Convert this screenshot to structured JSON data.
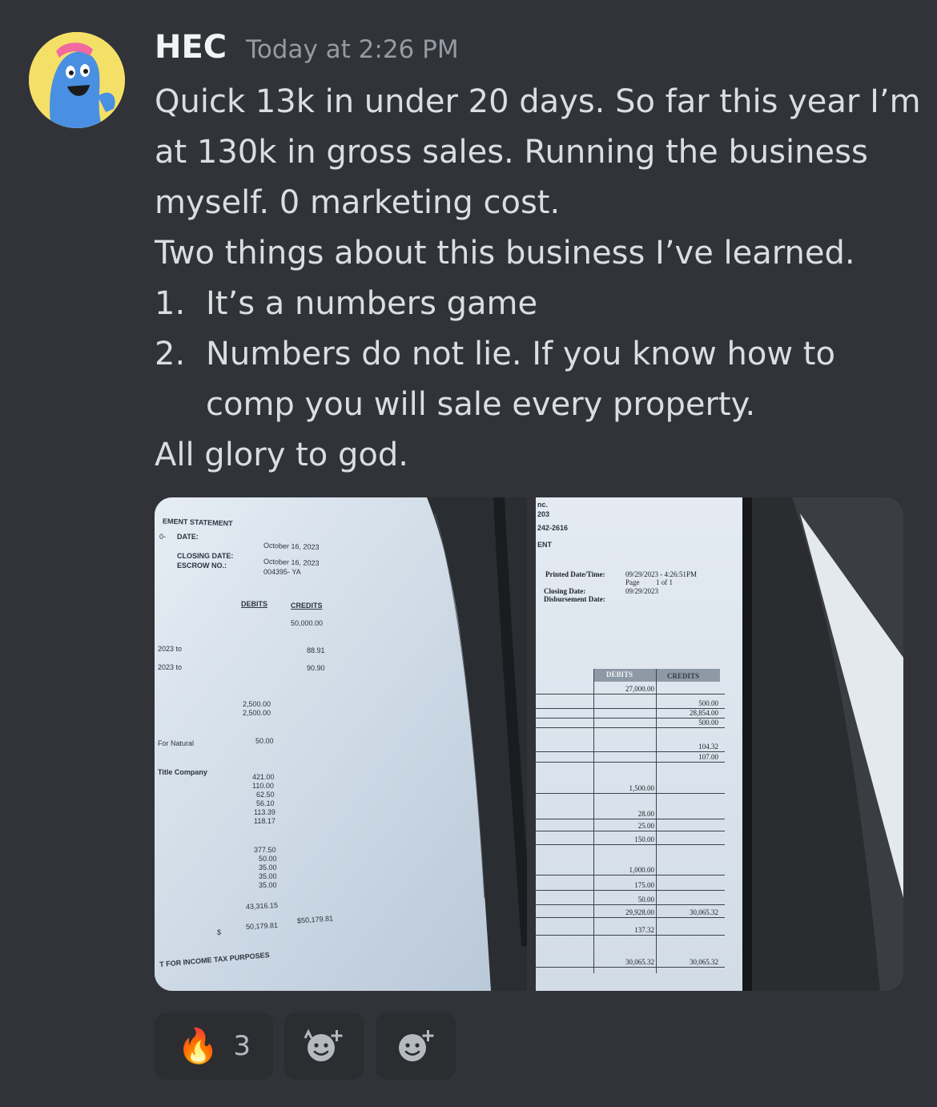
{
  "message": {
    "username": "HEC",
    "timestamp": "Today at 2:26 PM",
    "lines": [
      "Quick 13k in under 20 days. So far this year I’m",
      "at 130k in gross sales. Running the business",
      "myself. 0 marketing cost.",
      "Two things about this business I’ve learned."
    ],
    "list": [
      {
        "num": "1.",
        "lines": [
          "It’s a numbers game"
        ]
      },
      {
        "num": "2.",
        "lines": [
          "Numbers do not lie. If you know how to",
          "comp you will sale every property."
        ]
      }
    ],
    "closing": "All glory to god."
  },
  "photo_left": {
    "title": "EMENT STATEMENT",
    "date_label": "DATE:",
    "date_prefix": "0-",
    "date_value": "October 16, 2023",
    "closing_label": "CLOSING DATE:",
    "closing_value": "October 16, 2023",
    "escrow_label": "ESCROW NO.:",
    "escrow_value": "004395- YA",
    "debits_header": "DEBITS",
    "credits_header": "CREDITS",
    "row_labels": [
      "2023 to",
      "2023 to",
      "For Natural",
      "Title Company"
    ],
    "credits": [
      "50,000.00",
      "88.91",
      "90.90"
    ],
    "debits_a": [
      "2,500.00",
      "2,500.00"
    ],
    "debits_b": [
      "50.00"
    ],
    "debits_c": [
      "421.00",
      "110.00",
      "62.50",
      "56.10",
      "113.39",
      "118.17"
    ],
    "debits_d": [
      "377.50",
      "50.00",
      "35.00",
      "35.00",
      "35.00"
    ],
    "subtotal": "43,316.15",
    "dollar": "$",
    "total_debit": "50,179.81",
    "total_credit": "$50,179.81",
    "footer": "T FOR INCOME TAX PURPOSES"
  },
  "photo_right": {
    "top_lines": [
      "nc.",
      "203",
      "242-2616",
      "ENT"
    ],
    "printed_label": "Printed Date/Time:",
    "printed_value": "09/29/2023 - 4:26:51PM",
    "page_label": "Page",
    "page_value": "1  of 1",
    "closing_label": "Closing Date:",
    "closing_value": "09/29/2023",
    "disbursement_label": "Disbursement Date:",
    "debits_header": "DEBITS",
    "credits_header": "CREDITS",
    "rows": [
      {
        "debit": "27,000.00",
        "credit": ""
      },
      {
        "debit": "",
        "credit": "500.00"
      },
      {
        "debit": "",
        "credit": "28,854.00"
      },
      {
        "debit": "",
        "credit": "500.00"
      },
      {
        "debit": "",
        "credit": "104.32"
      },
      {
        "debit": "",
        "credit": "107.00"
      },
      {
        "debit": "1,500.00",
        "credit": ""
      },
      {
        "debit": "28.00",
        "credit": ""
      },
      {
        "debit": "25.00",
        "credit": ""
      },
      {
        "debit": "150.00",
        "credit": ""
      },
      {
        "debit": "1,000.00",
        "credit": ""
      },
      {
        "debit": "175.00",
        "credit": ""
      },
      {
        "debit": "50.00",
        "credit": ""
      },
      {
        "debit": "29,928.00",
        "credit": "30,065.32"
      },
      {
        "debit": "137.32",
        "credit": ""
      },
      {
        "debit": "30,065.32",
        "credit": "30,065.32"
      }
    ]
  },
  "reactions": [
    {
      "emoji": "🔥",
      "count": "3"
    }
  ]
}
